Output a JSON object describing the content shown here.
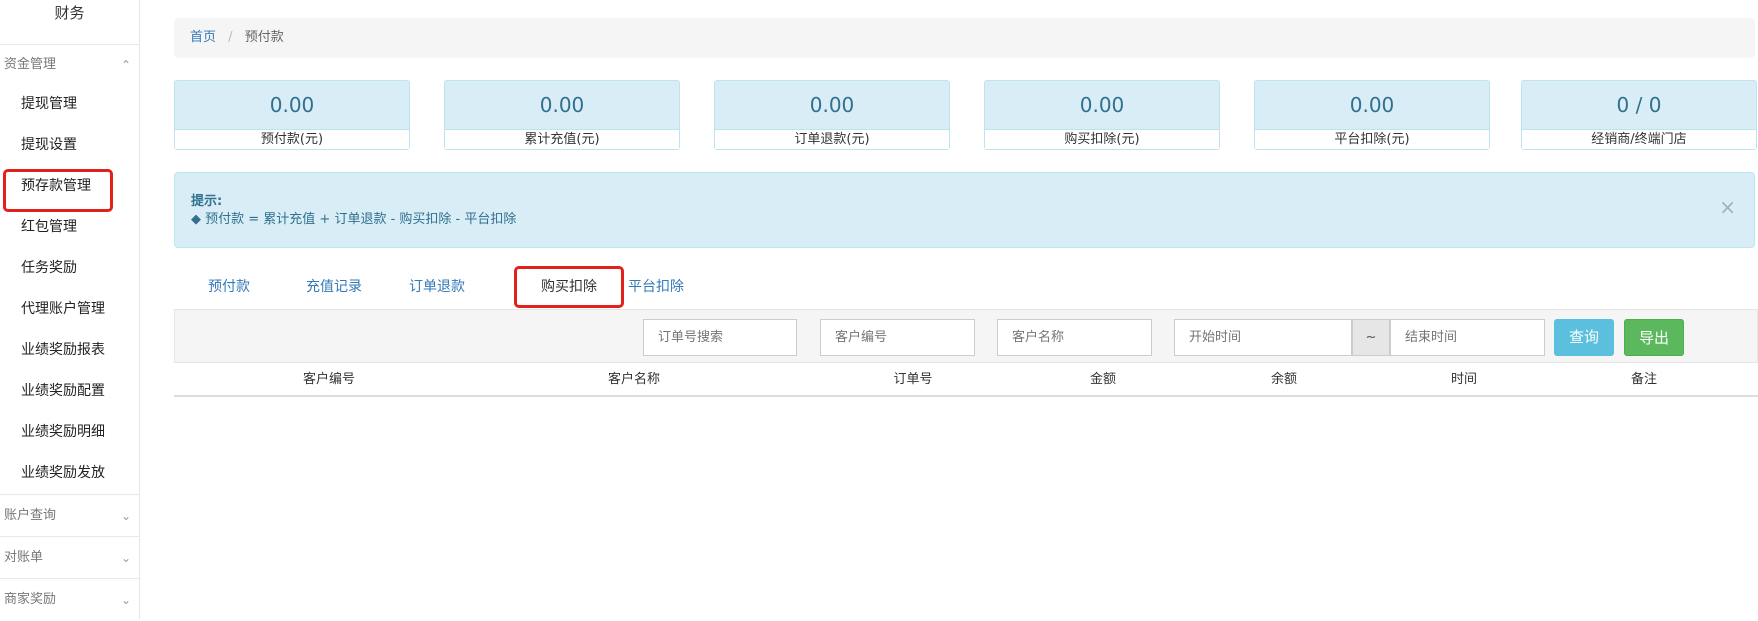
{
  "sidebar": {
    "title": "财务",
    "groups": [
      {
        "label": "资金管理",
        "expanded": true
      },
      {
        "label": "账户查询",
        "expanded": false
      },
      {
        "label": "对账单",
        "expanded": false
      },
      {
        "label": "商家奖励",
        "expanded": false
      }
    ],
    "items": [
      {
        "label": "提现管理"
      },
      {
        "label": "提现设置"
      },
      {
        "label": "预存款管理"
      },
      {
        "label": "红包管理"
      },
      {
        "label": "任务奖励"
      },
      {
        "label": "代理账户管理"
      },
      {
        "label": "业绩奖励报表"
      },
      {
        "label": "业绩奖励配置"
      },
      {
        "label": "业绩奖励明细"
      },
      {
        "label": "业绩奖励发放"
      }
    ]
  },
  "breadcrumb": {
    "home": "首页",
    "separator": "/",
    "current": "预付款"
  },
  "stats": [
    {
      "value": "0.00",
      "label": "预付款(元)"
    },
    {
      "value": "0.00",
      "label": "累计充值(元)"
    },
    {
      "value": "0.00",
      "label": "订单退款(元)"
    },
    {
      "value": "0.00",
      "label": "购买扣除(元)"
    },
    {
      "value": "0.00",
      "label": "平台扣除(元)"
    },
    {
      "value": "0 / 0",
      "label": "经销商/终端门店"
    }
  ],
  "alert": {
    "title": "提示:",
    "line": "◆ 预付款 = 累计充值 + 订单退款 - 购买扣除 - 平台扣除",
    "close": "×"
  },
  "tabs": [
    {
      "label": "预付款",
      "active": false
    },
    {
      "label": "充值记录",
      "active": false
    },
    {
      "label": "订单退款",
      "active": false
    },
    {
      "label": "购买扣除",
      "active": true
    },
    {
      "label": "平台扣除",
      "active": false
    }
  ],
  "filters": {
    "order_no_placeholder": "订单号搜索",
    "customer_no_placeholder": "客户编号",
    "customer_name_placeholder": "客户名称",
    "start_time_placeholder": "开始时间",
    "range_separator": "~",
    "end_time_placeholder": "结束时间",
    "query_label": "查询",
    "export_label": "导出"
  },
  "table": {
    "columns": [
      "客户编号",
      "客户名称",
      "订单号",
      "金额",
      "余额",
      "时间",
      "备注"
    ]
  },
  "colors": {
    "accent": "#337ab7",
    "info": "#5bc0de",
    "success": "#5cb85c",
    "highlight": "#e3201b",
    "alert_bg": "#d9edf7"
  }
}
